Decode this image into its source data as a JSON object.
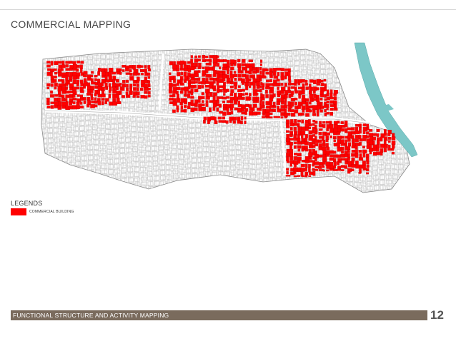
{
  "slide": {
    "title": "COMMERCIAL MAPPING",
    "footer_text": "FUNCTIONAL STRUCTURE AND ACTIVITY MAPPING",
    "page_number": "12"
  },
  "legend": {
    "title": "LEGENDS",
    "items": [
      {
        "label": "COMMERCIAL BUILDING",
        "color": "#ff0000"
      }
    ]
  },
  "map": {
    "commercial_color": "#ff0000",
    "water_color": "#7cc7c7",
    "building_outline_color": "#9a9a9a",
    "footer_bar_color": "#7a6b5d"
  }
}
